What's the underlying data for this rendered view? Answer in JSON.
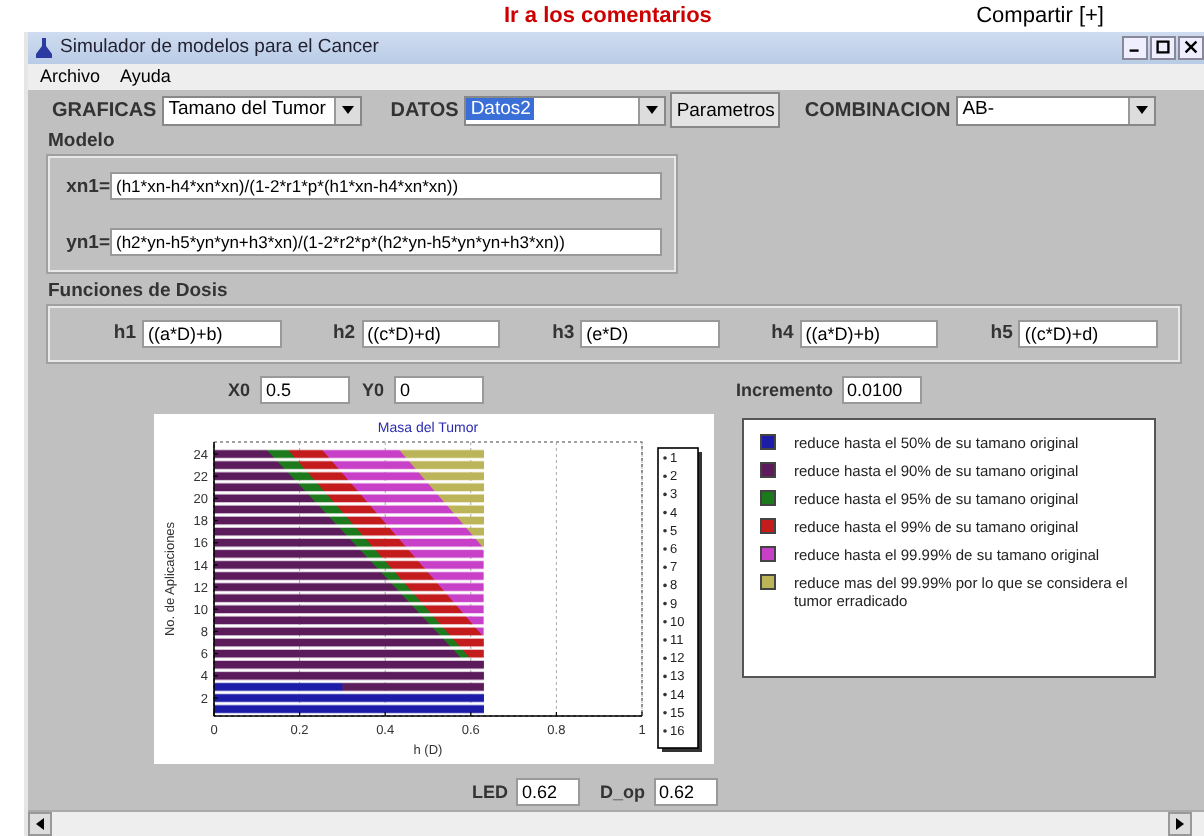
{
  "page_strip": {
    "link": "Ir a los comentarios",
    "share": "Compartir [+]"
  },
  "window": {
    "title": "Simulador de modelos para el Cancer"
  },
  "menu": [
    "Archivo",
    "Ayuda"
  ],
  "toolbar": {
    "graficas": {
      "label": "GRAFICAS",
      "value": "Tamano del Tumor"
    },
    "datos": {
      "label": "DATOS",
      "value": "Datos2",
      "highlighted": true
    },
    "parametros_button": "Parametros",
    "combinacion": {
      "label": "COMBINACION",
      "value": "AB-"
    }
  },
  "modelo": {
    "title": "Modelo",
    "equations": [
      {
        "label": "xn1=",
        "value": "(h1*xn-h4*xn*xn)/(1-2*r1*p*(h1*xn-h4*xn*xn))"
      },
      {
        "label": "yn1=",
        "value": "(h2*yn-h5*yn*yn+h3*xn)/(1-2*r2*p*(h2*yn-h5*yn*yn+h3*xn))"
      }
    ]
  },
  "dosis": {
    "title": "Funciones de Dosis",
    "functions": [
      {
        "label": "h1",
        "value": "((a*D)+b)"
      },
      {
        "label": "h2",
        "value": "((c*D)+d)"
      },
      {
        "label": "h3",
        "value": "(e*D)"
      },
      {
        "label": "h4",
        "value": "((a*D)+b)"
      },
      {
        "label": "h5",
        "value": "((c*D)+d)"
      }
    ]
  },
  "initial": [
    {
      "label": "X0",
      "value": "0.5"
    },
    {
      "label": "Y0",
      "value": "0"
    }
  ],
  "increment": {
    "label": "Incremento",
    "value": "0.0100"
  },
  "plot": {
    "title": "Masa del Tumor",
    "xlabel": "h (D)",
    "ylabel": "No. de Aplicaciones",
    "x_tick_labels": [
      "0",
      "0.2",
      "0.4",
      "0.6",
      "0.8",
      "1"
    ],
    "y_tick_labels": [
      "24",
      "22",
      "20",
      "18",
      "16",
      "14",
      "12",
      "10",
      "8",
      "6",
      "4",
      "2"
    ],
    "row_legend": [
      "1",
      "2",
      "3",
      "4",
      "5",
      "6",
      "7",
      "8",
      "9",
      "10",
      "11",
      "12",
      "13",
      "14",
      "15",
      "16"
    ]
  },
  "legend": [
    {
      "text": "reduce hasta el 50% de su tamano original",
      "color": "#1c1ca8"
    },
    {
      "text": "reduce hasta el 90% de su tamano original",
      "color": "#5c1c5c"
    },
    {
      "text": "reduce hasta el 95% de su tamano original",
      "color": "#1c7a1c"
    },
    {
      "text": "reduce hasta el 99% de su tamano original",
      "color": "#c41c1c"
    },
    {
      "text": "reduce hasta el 99.99% de su tamano original",
      "color": "#c840c8"
    },
    {
      "text": "reduce mas del 99.99% por lo que se considera el tumor erradicado",
      "color": "#bcb458"
    }
  ],
  "outputs": [
    {
      "label": "LED",
      "value": "0.62"
    },
    {
      "label": "D_op",
      "value": "0.62"
    }
  ]
}
